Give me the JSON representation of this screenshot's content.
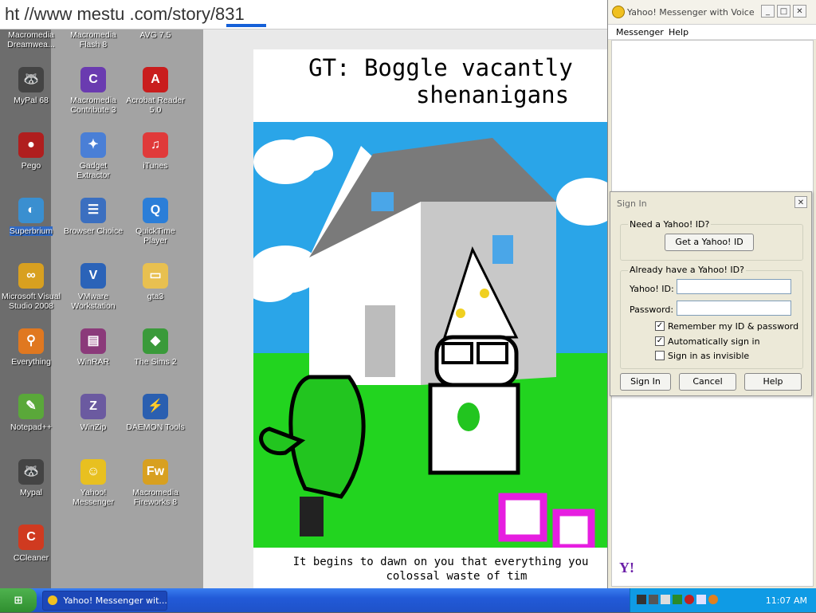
{
  "address_bar": {
    "url": "http://www.mspaintadventures.com/story/831",
    "visible_text": "ht   //www   mestu    .com/story/831"
  },
  "desktop_icons": [
    {
      "label": "Macromedia Dreamwea...",
      "icon": "dreamweaver-icon",
      "color": "#2f9a4a",
      "glyph": "Dw"
    },
    {
      "label": "Macromedia Flash 8",
      "icon": "flash-icon",
      "color": "#c8261f",
      "glyph": "f"
    },
    {
      "label": "AVG 7.5",
      "icon": "avg-icon",
      "color": "#2d6ad3",
      "glyph": "AVG"
    },
    {
      "label": "MyPal 68",
      "icon": "raccoon-icon",
      "color": "#444444",
      "glyph": "🦝"
    },
    {
      "label": "Macromedia Contribute 3",
      "icon": "contribute-icon",
      "color": "#6a3bb0",
      "glyph": "C"
    },
    {
      "label": "Acrobat Reader 5.0",
      "icon": "acrobat-icon",
      "color": "#c91d1d",
      "glyph": "A"
    },
    {
      "label": "Pego",
      "icon": "pego-icon",
      "color": "#b01e1e",
      "glyph": "●"
    },
    {
      "label": "Gadget Extractor",
      "icon": "gadget-icon",
      "color": "#4a7fd6",
      "glyph": "✦"
    },
    {
      "label": "iTunes",
      "icon": "itunes-icon",
      "color": "#e03a3a",
      "glyph": "♫"
    },
    {
      "label": "Superbrium",
      "icon": "globe-icon",
      "color": "#3a8fd0",
      "glyph": "◐"
    },
    {
      "label": "Browser Choice",
      "icon": "browser-choice-icon",
      "color": "#3b6fc0",
      "glyph": "☰"
    },
    {
      "label": "QuickTime Player",
      "icon": "quicktime-icon",
      "color": "#2b7ed8",
      "glyph": "Q"
    },
    {
      "label": "Microsoft Visual Studio 2008",
      "icon": "visual-studio-icon",
      "color": "#d8a020",
      "glyph": "∞"
    },
    {
      "label": "VMware Workstation",
      "icon": "vmware-icon",
      "color": "#2b63b8",
      "glyph": "V"
    },
    {
      "label": "gta3",
      "icon": "folder-icon",
      "color": "#e8c050",
      "glyph": "▭"
    },
    {
      "label": "Everything",
      "icon": "everything-icon",
      "color": "#e07820",
      "glyph": "⚲"
    },
    {
      "label": "WinRAR",
      "icon": "winrar-icon",
      "color": "#8b3a7a",
      "glyph": "▤"
    },
    {
      "label": "The Sims 2",
      "icon": "sims-icon",
      "color": "#3a9a3a",
      "glyph": "◆"
    },
    {
      "label": "Notepad++",
      "icon": "notepadpp-icon",
      "color": "#5aa83a",
      "glyph": "✎"
    },
    {
      "label": "WinZip",
      "icon": "winzip-icon",
      "color": "#6b5aa0",
      "glyph": "Z"
    },
    {
      "label": "DAEMON Tools",
      "icon": "daemon-tools-icon",
      "color": "#2a5fb0",
      "glyph": "⚡"
    },
    {
      "label": "Mypal",
      "icon": "raccoon-icon",
      "color": "#444444",
      "glyph": "🦝"
    },
    {
      "label": "Yahoo! Messenger",
      "icon": "yahoo-messenger-icon",
      "color": "#e8c020",
      "glyph": "☺"
    },
    {
      "label": "Macromedia Fireworks 8",
      "icon": "fireworks-icon",
      "color": "#d8a020",
      "glyph": "Fw"
    },
    {
      "label": "CCleaner",
      "icon": "ccleaner-icon",
      "color": "#d03a20",
      "glyph": "C"
    }
  ],
  "comic": {
    "title_line1": "GT: Boggle vacantly",
    "title_line2": "shenanigans",
    "caption_line1": "It begins to dawn on you that everything you",
    "caption_line2": "colossal waste of tim"
  },
  "ym_window": {
    "title": "Yahoo! Messenger with Voice",
    "menu": [
      "Messenger",
      "Help"
    ],
    "buttons": {
      "minimize": "_",
      "maximize": "□",
      "close": "✕"
    }
  },
  "signin_dialog": {
    "title": "Sign In",
    "need_id_label": "Need a Yahoo! ID?",
    "get_id_button": "Get a Yahoo! ID",
    "have_id_label": "Already have a Yahoo! ID?",
    "yahoo_id_label": "Yahoo! ID:",
    "password_label": "Password:",
    "yahoo_id_value": "",
    "password_value": "",
    "remember_label": "Remember my ID & password",
    "remember_checked": true,
    "auto_label": "Automatically sign in",
    "auto_checked": true,
    "invisible_label": "Sign in as invisible",
    "invisible_checked": false,
    "signin_button": "Sign In",
    "cancel_button": "Cancel",
    "help_button": "Help",
    "close": "✕"
  },
  "yahoo_logo": "Y!",
  "taskbar": {
    "start_label": "start",
    "task_label": "Yahoo! Messenger wit...",
    "time": "11:07 AM"
  }
}
